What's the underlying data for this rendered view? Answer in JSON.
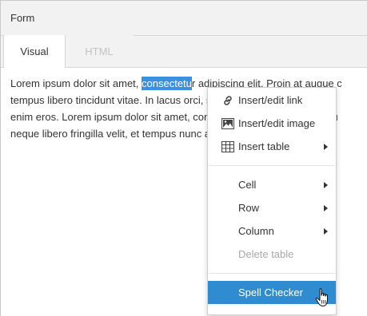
{
  "window": {
    "title": "Form"
  },
  "tabs": [
    {
      "label": "Visual",
      "active": true
    },
    {
      "label": "HTML",
      "active": false
    }
  ],
  "editor": {
    "lines": [
      {
        "before": "Lorem ipsum dolor sit amet, ",
        "selected": "consectetu",
        "after": "r adipiscing elit. Proin at augue c"
      },
      {
        "text": "tempus libero tincidunt vitae. In lacus orci, sagittis non interdum nec, m"
      },
      {
        "text": "enim eros. Lorem ipsum dolor sit amet, consectetur adipiscing elit. Mau"
      },
      {
        "text": "neque libero fringilla velit, et tempus nunc ante at nisi. Aliquam id mas"
      }
    ]
  },
  "context_menu": {
    "items": [
      {
        "label": "Insert/edit link",
        "icon": "link-icon"
      },
      {
        "label": "Insert/edit image",
        "icon": "image-icon"
      },
      {
        "label": "Insert table",
        "icon": "table-icon",
        "submenu": true
      },
      {
        "label": "Cell",
        "submenu": true
      },
      {
        "label": "Row",
        "submenu": true
      },
      {
        "label": "Column",
        "submenu": true
      },
      {
        "label": "Delete table",
        "disabled": true
      },
      {
        "label": "Spell Checker",
        "highlighted": true
      }
    ]
  },
  "colors": {
    "selection": "#3d8fe0",
    "menu_highlight": "#2f8cd0",
    "disabled_text": "#a8a8a8"
  }
}
